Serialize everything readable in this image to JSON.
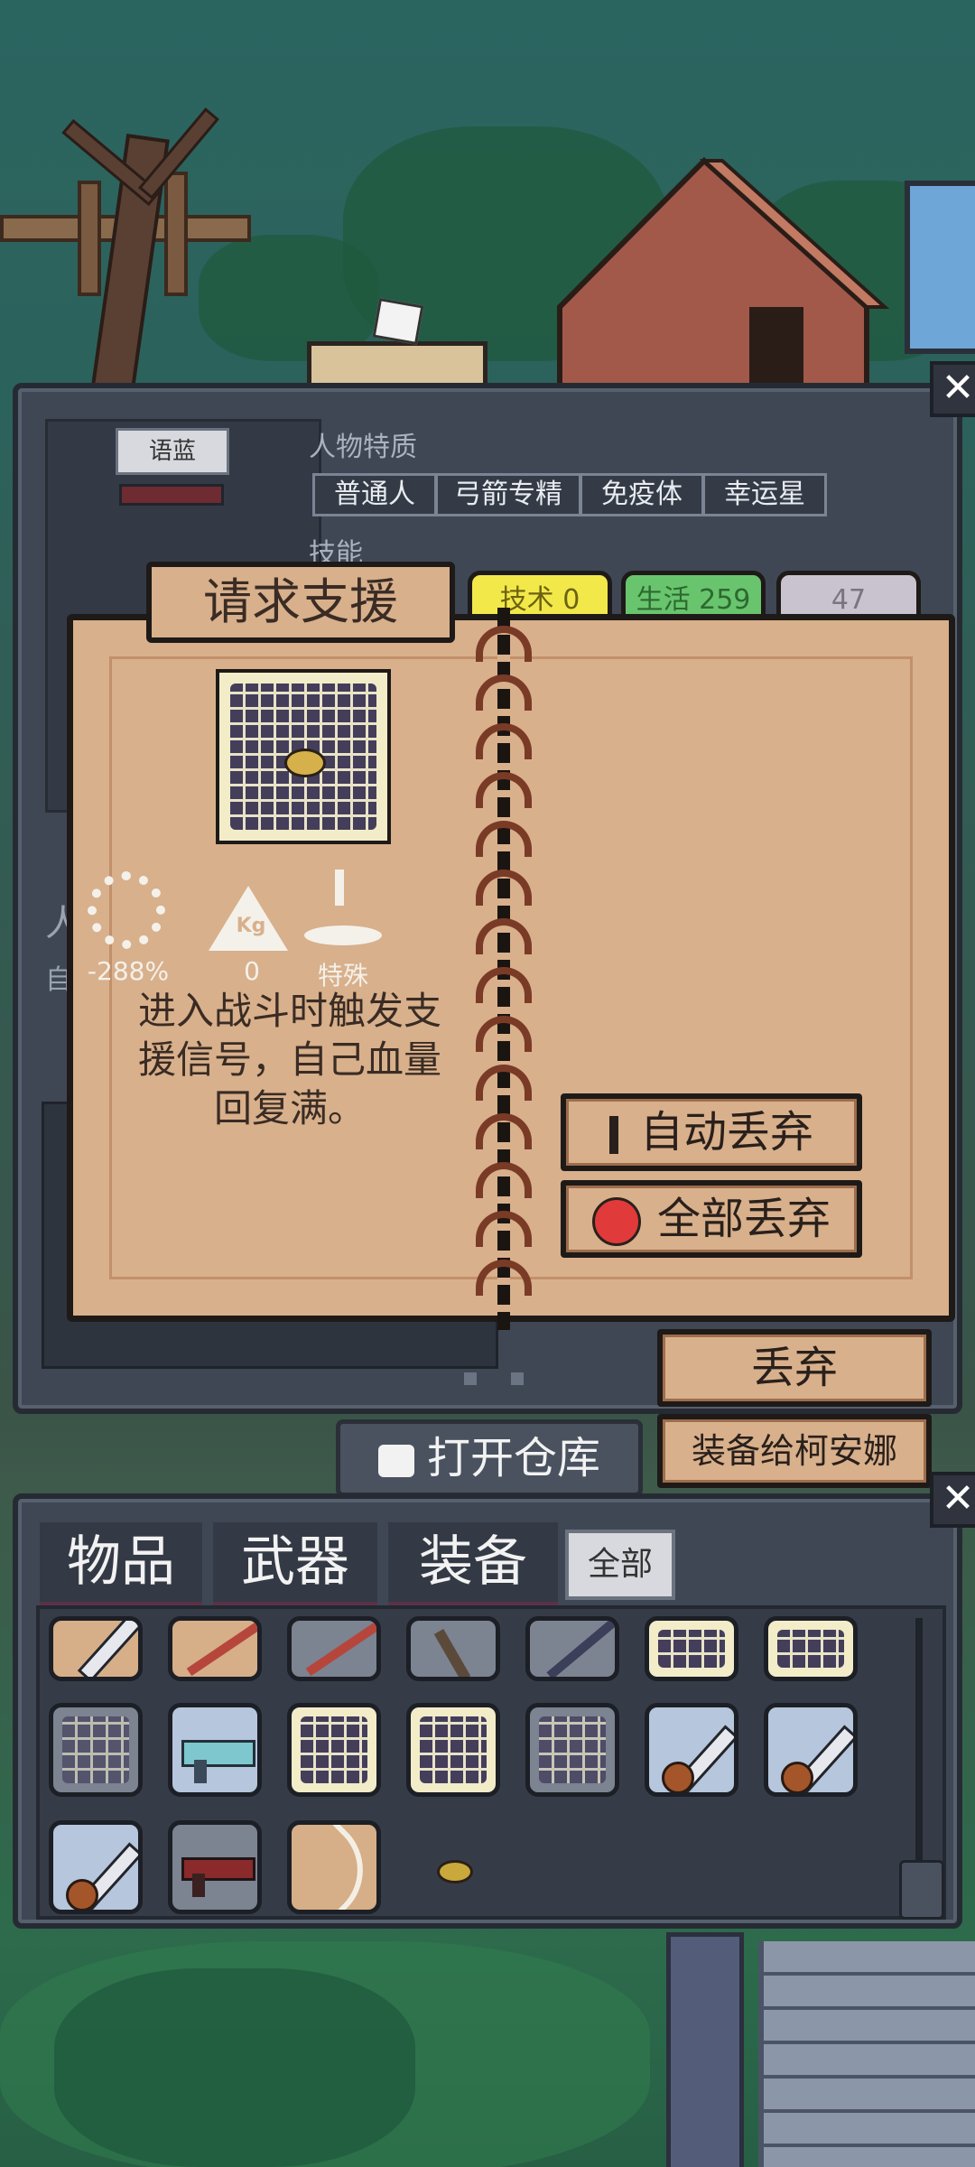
{
  "character_panel": {
    "name_tag": "语蓝",
    "traits_label": "人物特质",
    "traits": [
      "普通人",
      "弓箭专精",
      "免疫体",
      "幸运星"
    ],
    "skills_label": "技能",
    "side_label_1": "人",
    "side_label_2": "自",
    "close_label": "✕"
  },
  "book": {
    "title": "请求支援",
    "tabs": [
      {
        "label": "技术 0",
        "color": "#f2e84a"
      },
      {
        "label": "生活 259",
        "color": "#69c46e"
      },
      {
        "label": "47",
        "color": "#c9c2cf"
      }
    ],
    "stats": [
      {
        "icon": "gear-wrench-icon",
        "value": "-288%"
      },
      {
        "icon": "weight-icon",
        "weight_text": "Kg",
        "value": "0"
      },
      {
        "icon": "special-pedestal-icon",
        "value": "特殊"
      }
    ],
    "description": "进入战斗时触发支援信号，自己血量回复满。",
    "auto_discard_label": "自动丢弃",
    "discard_all_label": "全部丢弃"
  },
  "actions": {
    "discard_label": "丢弃",
    "equip_label": "装备给柯安娜",
    "open_storage_label": "打开仓库"
  },
  "inventory": {
    "tabs": [
      "物品",
      "武器",
      "装备"
    ],
    "filter_label": "全部",
    "close_label": "✕",
    "row1": [
      "knife",
      "red-stick",
      "red-stick",
      "hammer",
      "dark-stick",
      "chip",
      "chip"
    ],
    "row2": [
      "chip",
      "plasma-gun",
      "chip",
      "chip",
      "chip",
      "chainsaw",
      "chainsaw"
    ],
    "row3": [
      "chainsaw",
      "blaster",
      "bow",
      "small-item"
    ]
  }
}
